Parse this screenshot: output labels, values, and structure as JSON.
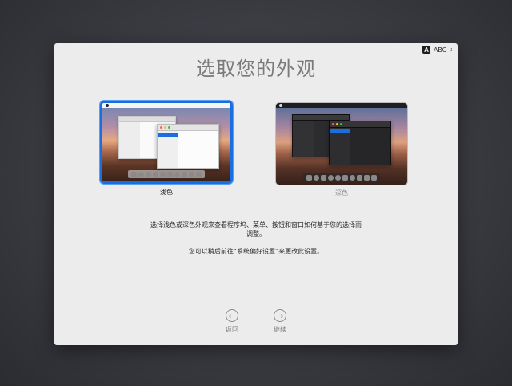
{
  "input_menu": {
    "badge": "A",
    "label": "ABC",
    "chevron": "⌃⌄"
  },
  "title": "选取您的外观",
  "options": [
    {
      "label": "浅色",
      "selected": true,
      "theme": "light"
    },
    {
      "label": "深色",
      "selected": false,
      "theme": "dark"
    }
  ],
  "description": {
    "line1": "选择浅色或深色外观来查看程序坞、菜单、按钮和窗口如何基于您的选择而",
    "line2": "调整。",
    "line3": "您可以稍后前往“系统偏好设置”来更改此设置。"
  },
  "nav": {
    "back_label": "返回",
    "back_icon": "arrow-left-circle-icon",
    "next_label": "继续",
    "next_icon": "arrow-right-circle-icon"
  },
  "colors": {
    "accent": "#1a6fe0",
    "window_bg": "#ececec",
    "title": "#7a7a7a"
  }
}
